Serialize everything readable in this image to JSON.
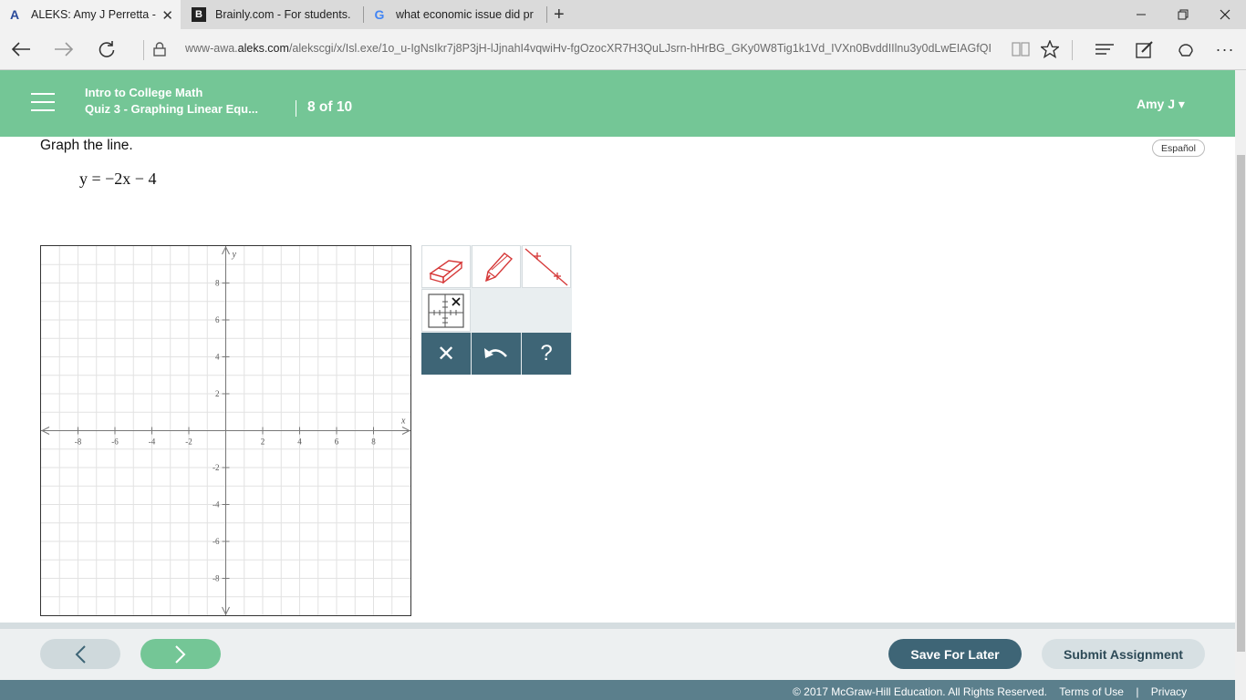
{
  "browser": {
    "tabs": [
      {
        "icon": "A",
        "title": "ALEKS: Amy J Perretta -",
        "active": true
      },
      {
        "icon": "B",
        "title": "Brainly.com - For students.",
        "active": false
      },
      {
        "icon": "G",
        "title": "what economic issue did pr",
        "active": false
      }
    ],
    "new_tab": "+",
    "url_prefix": "www-awa.",
    "url_domain": "aleks.com",
    "url_rest": "/alekscgi/x/Isl.exe/1o_u-IgNsIkr7j8P3jH-lJjnahI4vqwiHv-fgOzocXR7H3QuLJsrn-hHrBG_GKy0W8Tig1k1Vd_IVXn0BvddIIlnu3y0dLwEIAGfQI"
  },
  "header": {
    "course": "Intro to College Math",
    "quiz": "Quiz 3 - Graphing Linear Equ...",
    "progress": "8 of 10",
    "user": "Amy J ▾"
  },
  "question": {
    "instruction": "Graph the line.",
    "equation": "y = −2x − 4",
    "espanol": "Español"
  },
  "graph": {
    "x_label": "x",
    "y_label": "y",
    "x_range": [
      -10,
      10
    ],
    "y_range": [
      -10,
      10
    ],
    "x_ticks": [
      "-8",
      "-6",
      "-4",
      "-2",
      "2",
      "4",
      "6",
      "8"
    ],
    "y_ticks": [
      "8",
      "6",
      "4",
      "2",
      "-2",
      "-4",
      "-6",
      "-8"
    ]
  },
  "tools": {
    "eraser": "eraser-icon",
    "pencil": "pencil-icon",
    "line": "line-tool-icon",
    "grid": "grid-settings-icon",
    "clear": "✕",
    "undo": "↶",
    "help": "?"
  },
  "footer": {
    "prev": "‹",
    "next": "›",
    "save_later": "Save For Later",
    "submit": "Submit Assignment",
    "copyright": "© 2017 McGraw-Hill Education. All Rights Reserved.",
    "terms": "Terms of Use",
    "divider": "|",
    "privacy": "Privacy"
  },
  "colors": {
    "header": "#74c696",
    "dark_button": "#3e6576"
  }
}
